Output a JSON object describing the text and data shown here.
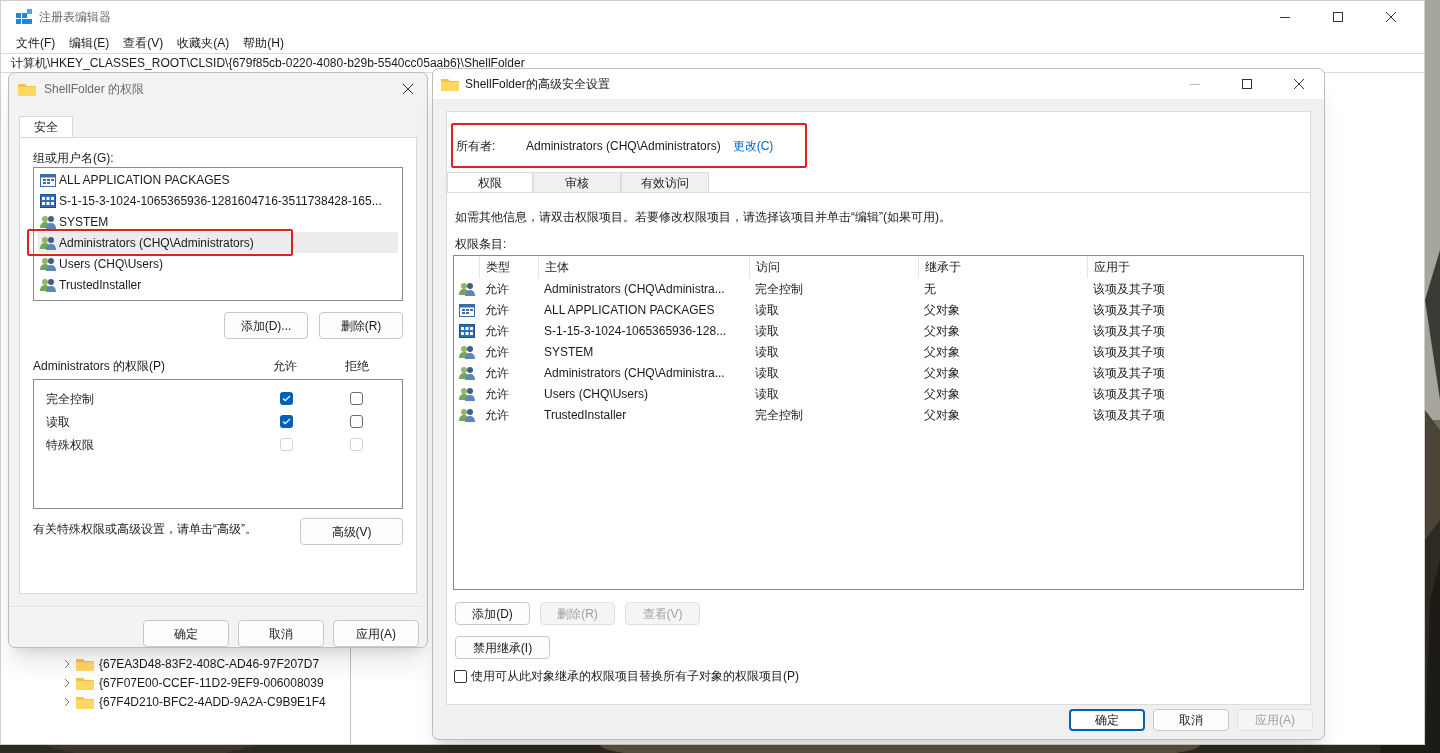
{
  "registry_editor": {
    "title": "注册表编辑器",
    "menu": [
      "文件(F)",
      "编辑(E)",
      "查看(V)",
      "收藏夹(A)",
      "帮助(H)"
    ],
    "address": "计算机\\HKEY_CLASSES_ROOT\\CLSID\\{679f85cb-0220-4080-b29b-5540cc05aab6}\\ShellFolder",
    "tree_items": [
      "{67EA3D48-83F2-408C-AD46-97F207D7",
      "{67F07E00-CCEF-11D2-9EF9-006008039",
      "{67F4D210-BFC2-4ADD-9A2A-C9B9E1F4"
    ]
  },
  "permissions_dialog": {
    "title": "ShellFolder 的权限",
    "tabs": [
      {
        "label": "安全",
        "selected": true
      }
    ],
    "group_label": "组或用户名(G):",
    "groups": [
      {
        "name": "ALL APPLICATION PACKAGES",
        "kind": "package",
        "selected": false,
        "highlighted": false
      },
      {
        "name": "S-1-15-3-1024-1065365936-1281604716-3511738428-165...",
        "kind": "sid",
        "selected": false,
        "highlighted": false
      },
      {
        "name": "SYSTEM",
        "kind": "users",
        "selected": false,
        "highlighted": false
      },
      {
        "name": "Administrators (CHQ\\Administrators)",
        "kind": "users",
        "selected": true,
        "highlighted": true
      },
      {
        "name": "Users (CHQ\\Users)",
        "kind": "users",
        "selected": false,
        "highlighted": false
      },
      {
        "name": "TrustedInstaller",
        "kind": "users",
        "selected": false,
        "highlighted": false
      }
    ],
    "group_buttons": [
      "添加(D)...",
      "删除(R)"
    ],
    "permissions_label": "Administrators 的权限(P)",
    "allow_header": "允许",
    "deny_header": "拒绝",
    "permissions": [
      {
        "name": "完全控制",
        "allow": true,
        "deny": false,
        "disabled": false
      },
      {
        "name": "读取",
        "allow": true,
        "deny": false,
        "disabled": false
      },
      {
        "name": "特殊权限",
        "allow": false,
        "deny": false,
        "disabled": true
      }
    ],
    "advanced_hint": "有关特殊权限或高级设置，请单击“高级”。",
    "advanced_button": "高级(V)",
    "footer_buttons": [
      {
        "label": "确定",
        "default": false,
        "disabled": false
      },
      {
        "label": "取消",
        "default": false,
        "disabled": false
      },
      {
        "label": "应用(A)",
        "default": false,
        "disabled": false
      }
    ]
  },
  "advanced_dialog": {
    "title": "ShellFolder的高级安全设置",
    "owner": {
      "label": "所有者:",
      "value": "Administrators (CHQ\\Administrators)",
      "link": "更改(C)",
      "highlighted": true
    },
    "tabs": [
      {
        "label": "权限",
        "selected": true
      },
      {
        "label": "审核",
        "selected": false
      },
      {
        "label": "有效访问",
        "selected": false
      }
    ],
    "info": "如需其他信息，请双击权限项目。若要修改权限项目，请选择该项目并单击“编辑”(如果可用)。",
    "entries_label": "权限条目:",
    "table": {
      "columns": [
        "类型",
        "主体",
        "访问",
        "继承于",
        "应用于"
      ],
      "rows": [
        {
          "kind": "users",
          "cells": [
            "允许",
            "Administrators (CHQ\\Administra...",
            "完全控制",
            "无",
            "该项及其子项"
          ]
        },
        {
          "kind": "package",
          "cells": [
            "允许",
            "ALL APPLICATION PACKAGES",
            "读取",
            "父对象",
            "该项及其子项"
          ]
        },
        {
          "kind": "sid",
          "cells": [
            "允许",
            "S-1-15-3-1024-1065365936-128...",
            "读取",
            "父对象",
            "该项及其子项"
          ]
        },
        {
          "kind": "users",
          "cells": [
            "允许",
            "SYSTEM",
            "读取",
            "父对象",
            "该项及其子项"
          ]
        },
        {
          "kind": "users",
          "cells": [
            "允许",
            "Administrators (CHQ\\Administra...",
            "读取",
            "父对象",
            "该项及其子项"
          ]
        },
        {
          "kind": "users",
          "cells": [
            "允许",
            "Users (CHQ\\Users)",
            "读取",
            "父对象",
            "该项及其子项"
          ]
        },
        {
          "kind": "users",
          "cells": [
            "允许",
            "TrustedInstaller",
            "完全控制",
            "父对象",
            "该项及其子项"
          ]
        }
      ]
    },
    "entry_buttons": [
      {
        "label": "添加(D)",
        "disabled": false
      },
      {
        "label": "删除(R)",
        "disabled": true
      },
      {
        "label": "查看(V)",
        "disabled": true
      }
    ],
    "inheritance_button": "禁用继承(I)",
    "replace_checkbox": {
      "label": "使用可从此对象继承的权限项目替换所有子对象的权限项目(P)",
      "checked": false
    },
    "footer_buttons": [
      {
        "label": "确定",
        "default": true,
        "disabled": false
      },
      {
        "label": "取消",
        "default": false,
        "disabled": false
      },
      {
        "label": "应用(A)",
        "default": false,
        "disabled": true
      }
    ]
  }
}
